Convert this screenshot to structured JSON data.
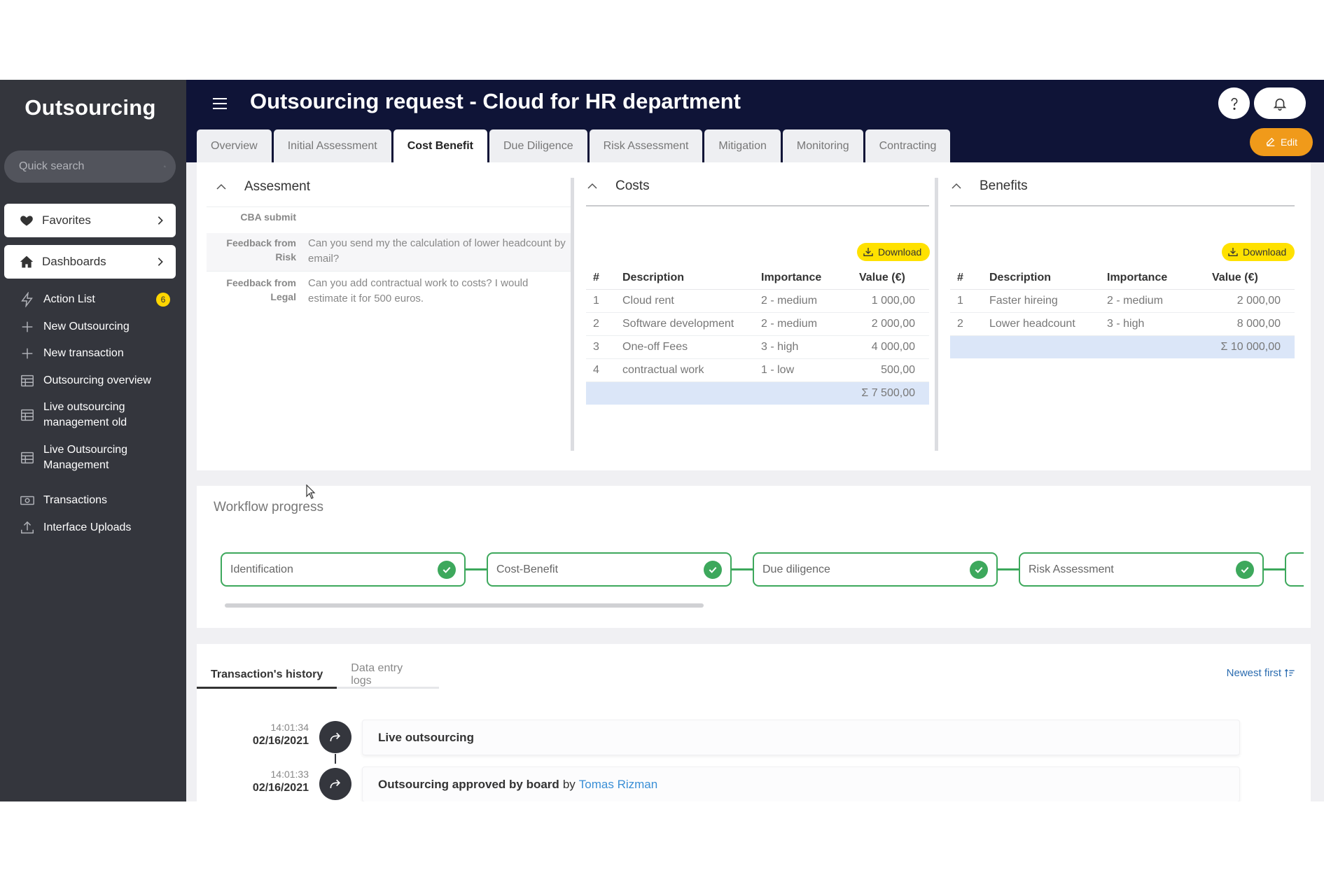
{
  "sidebar": {
    "app_title": "Outsourcing",
    "search_placeholder": "Quick search",
    "favorites_label": "Favorites",
    "dashboards_label": "Dashboards",
    "items": [
      {
        "label": "Action List",
        "icon": "bolt-icon",
        "badge": "6"
      },
      {
        "label": "New Outsourcing",
        "icon": "plus-icon"
      },
      {
        "label": "New transaction",
        "icon": "plus-icon"
      },
      {
        "label": "Outsourcing overview",
        "icon": "table-icon"
      },
      {
        "label": "Live outsourcing management old",
        "icon": "table-icon"
      },
      {
        "label": "Live Outsourcing Management",
        "icon": "table-icon"
      },
      {
        "label": "Transactions",
        "icon": "money-icon"
      },
      {
        "label": "Interface Uploads",
        "icon": "upload-icon"
      }
    ]
  },
  "header": {
    "title": "Outsourcing request - Cloud for HR department",
    "edit_label": "Edit",
    "tabs": [
      {
        "label": "Overview"
      },
      {
        "label": "Initial Assessment"
      },
      {
        "label": "Cost Benefit",
        "active": true
      },
      {
        "label": "Due Diligence"
      },
      {
        "label": "Risk Assessment"
      },
      {
        "label": "Mitigation"
      },
      {
        "label": "Monitoring"
      },
      {
        "label": "Contracting"
      }
    ]
  },
  "assessment": {
    "title": "Assesment",
    "rows": [
      {
        "key": "CBA submit",
        "value": ""
      },
      {
        "key": "Feedback from Risk",
        "value": "Can you send my the calculation of lower headcount by email?"
      },
      {
        "key": "Feedback from Legal",
        "value": "Can you add contractual work to costs? I would estimate it for 500 euros."
      }
    ]
  },
  "costs": {
    "title": "Costs",
    "download_label": "Download",
    "columns": [
      "#",
      "Description",
      "Importance",
      "Value (€)"
    ],
    "rows": [
      [
        "1",
        "Cloud rent",
        "2 - medium",
        "1 000,00"
      ],
      [
        "2",
        "Software development",
        "2 - medium",
        "2 000,00"
      ],
      [
        "3",
        "One-off Fees",
        "3 - high",
        "4 000,00"
      ],
      [
        "4",
        "contractual work",
        "1 - low",
        "500,00"
      ]
    ],
    "total": "Σ 7 500,00"
  },
  "benefits": {
    "title": "Benefits",
    "download_label": "Download",
    "columns": [
      "#",
      "Description",
      "Importance",
      "Value (€)"
    ],
    "rows": [
      [
        "1",
        "Faster hireing",
        "2 - medium",
        "2 000,00"
      ],
      [
        "2",
        "Lower headcount",
        "3 - high",
        "8 000,00"
      ]
    ],
    "total": "Σ 10 000,00"
  },
  "workflow": {
    "title": "Workflow progress",
    "steps": [
      {
        "label": "Identification",
        "done": true
      },
      {
        "label": "Cost-Benefit",
        "done": true
      },
      {
        "label": "Due diligence",
        "done": true
      },
      {
        "label": "Risk Assessment",
        "done": true
      }
    ]
  },
  "history": {
    "tabs": [
      "Transaction's history",
      "Data entry logs"
    ],
    "sort_label": "Newest first",
    "entries": [
      {
        "time": "14:01:34",
        "date": "02/16/2021",
        "text": "Live outsourcing",
        "by": "",
        "user": ""
      },
      {
        "time": "14:01:33",
        "date": "02/16/2021",
        "text": "Outsourcing approved by board",
        "by": "by",
        "user": "Tomas Rizman"
      }
    ]
  },
  "colors": {
    "sidebar": "#34363d",
    "header": "#0f1437",
    "accent_orange": "#f09a1a",
    "download_yellow": "#ffe100",
    "success_green": "#3da85c",
    "sum_row": "#dbe6f8",
    "link_blue": "#3a8fd6"
  }
}
